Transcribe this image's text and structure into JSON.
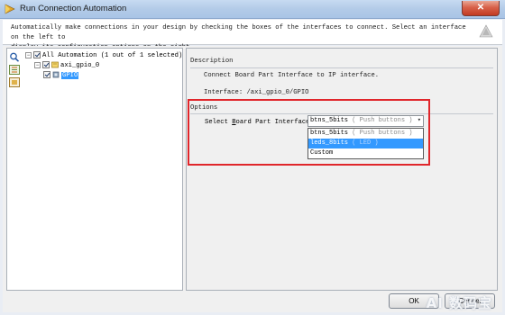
{
  "window": {
    "title": "Run Connection Automation",
    "close_glyph": "✕"
  },
  "header": {
    "message_line1": "Automatically make connections in your design by checking the boxes of the interfaces to connect. Select an interface on the left to",
    "message_line2": "display its configuration options on the right."
  },
  "tree": {
    "root_label": "All Automation (1 out of 1 selected)",
    "child_label": "axi_gpio_0",
    "leaf_label": "GPIO"
  },
  "description": {
    "heading": "Description",
    "line1": "Connect Board Part Interface to IP interface.",
    "line2": "Interface: /axi_gpio_0/GPIO"
  },
  "options": {
    "heading": "Options",
    "field_label_prefix": "Select ",
    "field_label_mnemonic": "B",
    "field_label_suffix": "oard Part Interface:",
    "selected_value": "btns_5bits",
    "selected_hint": "( Push buttons )",
    "dropdown_items": [
      {
        "value": "btns_5bits",
        "hint": "( Push buttons )"
      },
      {
        "value": "leds_8bits",
        "hint": "( LED )"
      },
      {
        "value": "Custom",
        "hint": ""
      }
    ]
  },
  "buttons": {
    "ok": "OK",
    "cancel": "Cancel"
  },
  "watermark": "AI 数码宝",
  "colors": {
    "selection": "#3399ff",
    "annotation": "#e0262b"
  }
}
